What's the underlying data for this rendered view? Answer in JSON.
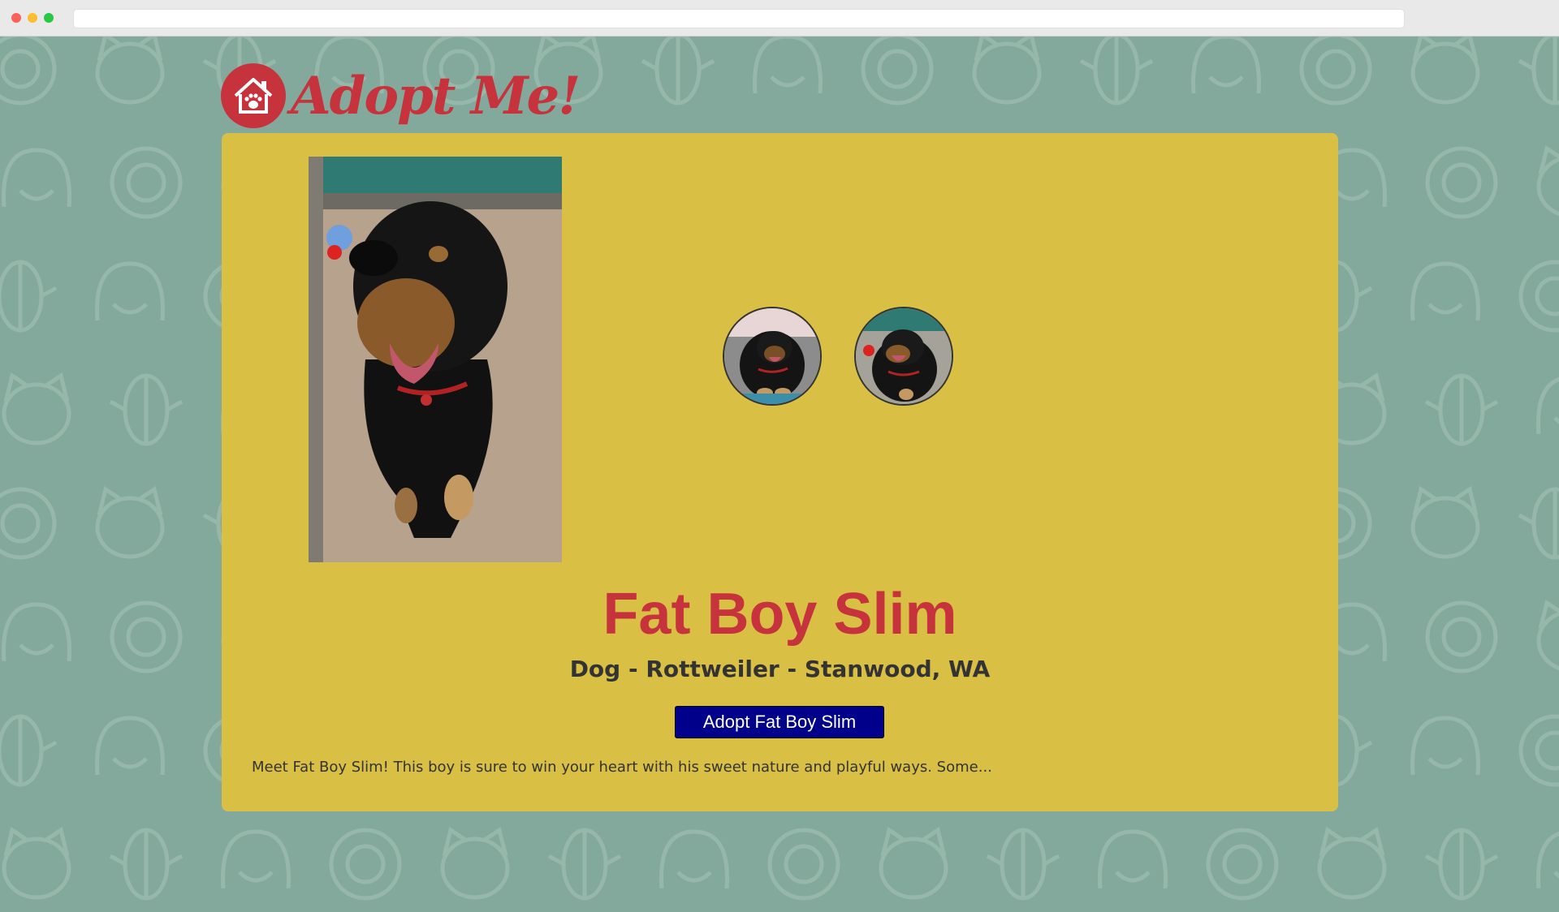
{
  "browser": {
    "url": ""
  },
  "header": {
    "logo_text": "Adopt Me!",
    "logo_icon": "house-paw-icon"
  },
  "details": {
    "pet_name": "Fat Boy Slim",
    "animal": "Dog",
    "breed": "Rottweiler",
    "location": "Stanwood, WA",
    "meta_line": "Dog - Rottweiler - Stanwood, WA",
    "adopt_button_label": "Adopt Fat Boy Slim",
    "description": "Meet Fat Boy Slim! This boy is sure to win your heart with his sweet nature and playful ways. Some...",
    "main_photo_alt": "Fat Boy Slim",
    "thumbnails": [
      {
        "alt": "thumbnail 1"
      },
      {
        "alt": "thumbnail 2"
      }
    ]
  },
  "colors": {
    "background": "#83a99c",
    "card": "#d9c045",
    "brand_red": "#c7333d",
    "button": "#00008b"
  }
}
